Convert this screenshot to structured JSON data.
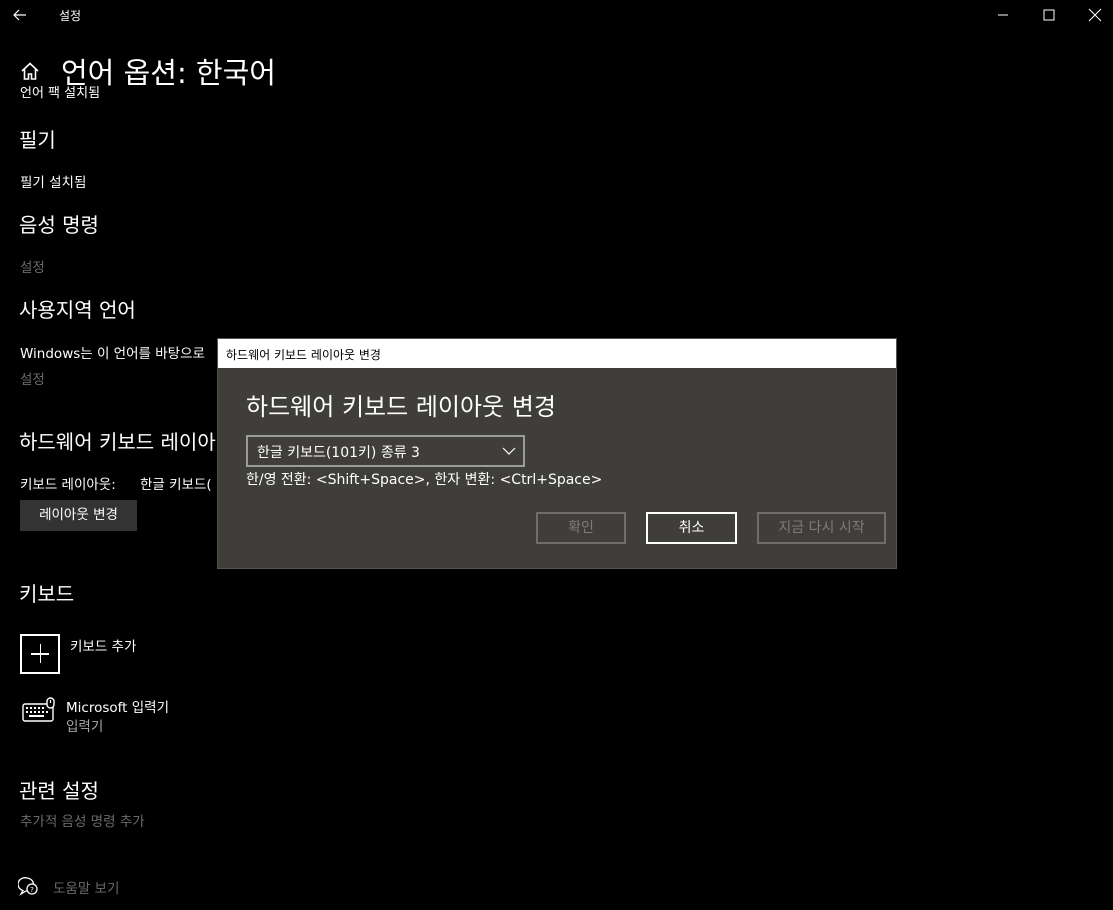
{
  "window": {
    "title": "설정",
    "back_icon": "back-arrow-icon",
    "min_icon": "minimize-icon",
    "max_icon": "maximize-icon",
    "close_icon": "close-icon"
  },
  "header": {
    "home_icon": "home-icon",
    "title": "언어 옵션: 한국어"
  },
  "sections": {
    "clipped_line": "언어 팩 설치됨",
    "handwriting_heading": "필기",
    "handwriting_status": "필기 설치됨",
    "speech_heading": "음성 명령",
    "speech_link": "설정",
    "regional_heading": "사용지역 언어",
    "regional_text": "Windows는 이 언어를 바탕으로",
    "regional_link": "설정",
    "hardware_heading": "하드웨어 키보드 레이아",
    "layout_label": "키보드 레이아웃:",
    "layout_value": "한글 키보드(",
    "change_layout_button": "레이아웃 변경",
    "keyboard_heading": "키보드",
    "add_keyboard": "키보드 추가",
    "ime_name": "Microsoft 입력기",
    "ime_sub": "입력기",
    "related_heading": "관련 설정",
    "related_link": "추가적 음성 명령 추가",
    "help_link": "도움말 보기"
  },
  "dialog": {
    "window_title": "하드웨어 키보드 레이아웃 변경",
    "heading": "하드웨어 키보드 레이아웃 변경",
    "select_value": "한글 키보드(101키) 종류 3",
    "hotkey_text": "한/영 전환: <Shift+Space>, 한자 변환: <Ctrl+Space>",
    "ok_label": "확인",
    "cancel_label": "취소",
    "restart_label": "지금 다시 시작"
  },
  "colors": {
    "background": "#000000",
    "dialog_bg": "#3f3e3a",
    "disabled_text": "#7d7c78",
    "muted_text": "#6b6b6b",
    "button_bg": "#333333"
  }
}
